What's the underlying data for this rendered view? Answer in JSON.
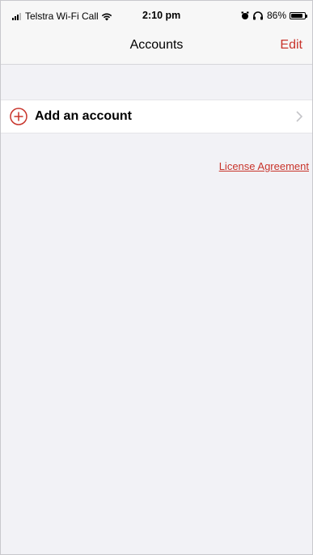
{
  "status_bar": {
    "carrier": "Telstra Wi-Fi Call",
    "time": "2:10 pm",
    "battery_percent": "86%",
    "battery_level": 0.86,
    "icons": [
      "signal-icon",
      "wifi-icon",
      "alarm-icon",
      "headphones-icon",
      "battery-icon"
    ]
  },
  "nav": {
    "title": "Accounts",
    "edit_label": "Edit"
  },
  "accounts": {
    "add_label": "Add an account",
    "add_icon": "plus-circle-icon",
    "chevron_icon": "chevron-right-icon"
  },
  "footer": {
    "license_label": "License Agreement"
  },
  "colors": {
    "accent": "#c8342b",
    "background": "#f2f2f6",
    "bar": "#f7f7f7"
  }
}
